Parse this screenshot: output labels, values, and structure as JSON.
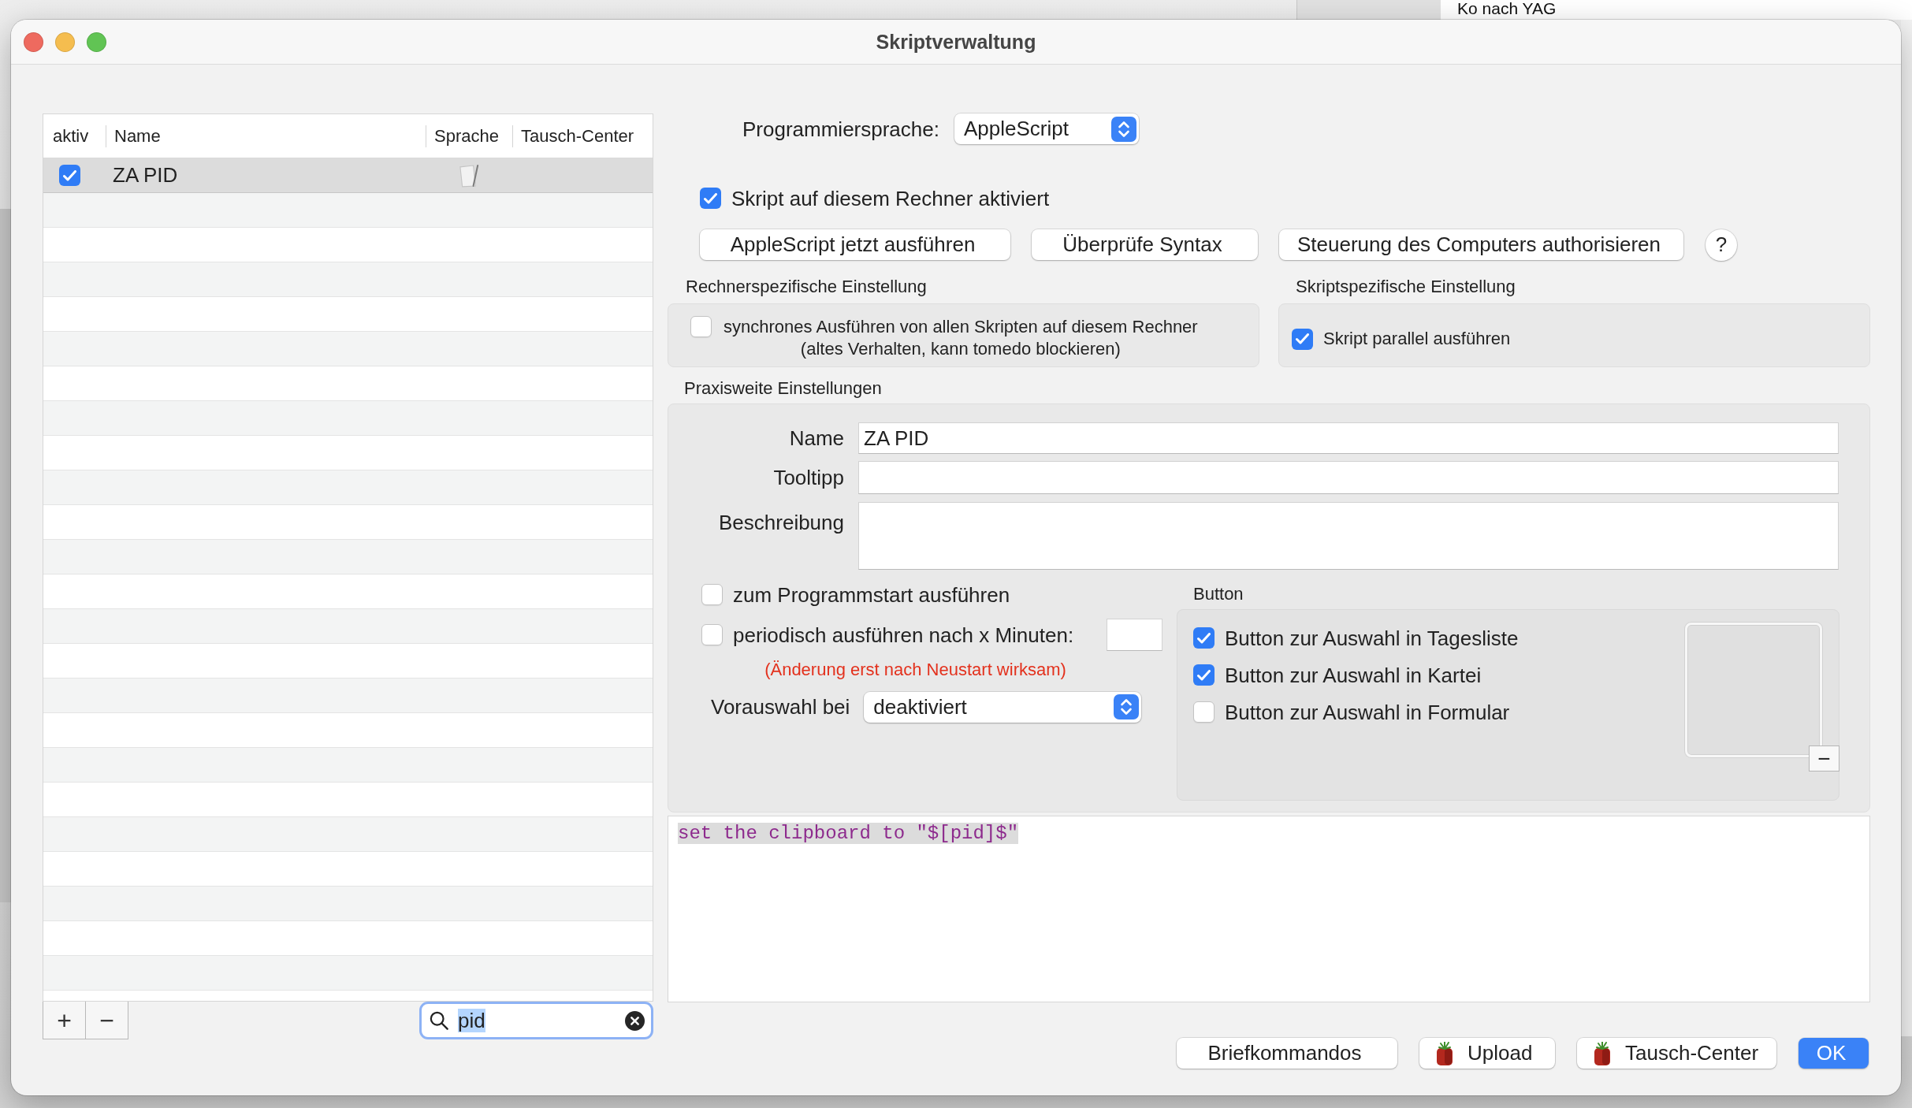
{
  "background_window": {
    "text": "Ko nach YAG"
  },
  "window": {
    "title": "Skriptverwaltung"
  },
  "script_table": {
    "columns": [
      "aktiv",
      "Name",
      "Sprache",
      "Tausch-Center"
    ],
    "rows": [
      {
        "active": true,
        "name": "ZA PID",
        "selected": true
      }
    ]
  },
  "list_toolbar": {
    "add_button": "+",
    "remove_button": "−",
    "search": {
      "value": "pid",
      "text_selected": true
    }
  },
  "language": {
    "label": "Programmiersprache:",
    "value": "AppleScript"
  },
  "enabled": {
    "label": "Skript auf diesem Rechner aktiviert",
    "checked": true
  },
  "actions": [
    "AppleScript jetzt ausführen",
    "Überprüfe Syntax",
    "Steuerung des Computers authorisieren"
  ],
  "help_button": "?",
  "machine_settings": {
    "title": "Rechnerspezifische Einstellung",
    "option": {
      "label": "synchrones Ausführen von allen Skripten auf diesem Rechner\n(altes Verhalten, kann tomedo blockieren)",
      "checked": false
    }
  },
  "script_settings": {
    "title": "Skriptspezifische Einstellung",
    "option": {
      "label": "Skript parallel ausführen",
      "checked": true
    }
  },
  "practice_settings": {
    "title": "Praxisweite Einstellungen",
    "fields": [
      {
        "label": "Name",
        "value": "ZA PID",
        "kind": "line"
      },
      {
        "label": "Tooltipp",
        "kind": "line"
      },
      {
        "label": "Beschreibung",
        "kind": "area"
      }
    ],
    "run_on_start": {
      "label": "zum Programmstart ausführen",
      "checked": false
    },
    "periodic": {
      "label": "periodisch ausführen nach x Minuten:",
      "checked": false
    },
    "restart_note": "(Änderung erst nach Neustart wirksam)",
    "preselect": {
      "label": "Vorauswahl bei",
      "value": "deaktiviert"
    },
    "button_group": {
      "title": "Button",
      "options": [
        {
          "label": "Button zur Auswahl in Tagesliste",
          "checked": true
        },
        {
          "label": "Button zur Auswahl in Kartei",
          "checked": true
        },
        {
          "label": "Button zur Auswahl in Formular",
          "checked": false
        }
      ],
      "remove_image_button": "−"
    }
  },
  "code": {
    "text": "set the clipboard to \"$[pid]$\"",
    "highlighted": true
  },
  "footer_buttons": [
    {
      "label": "Briefkommandos",
      "kind": "plain"
    },
    {
      "label": "Upload",
      "kind": "tomato"
    },
    {
      "label": "Tausch-Center",
      "kind": "tomato"
    },
    {
      "label": "OK",
      "kind": "default"
    }
  ]
}
